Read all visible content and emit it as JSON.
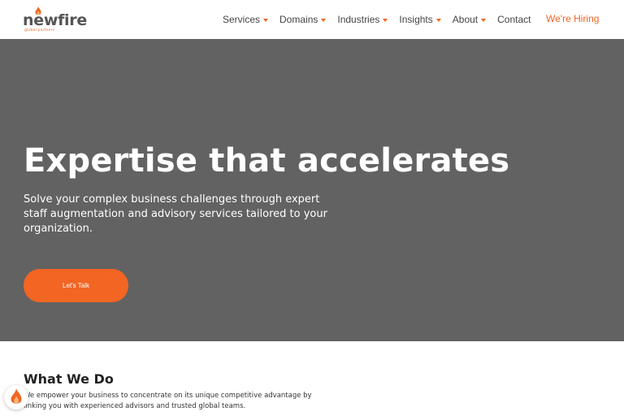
{
  "brand": {
    "name": "newfire",
    "tagline": "global partners",
    "accent_color": "#f26522",
    "hero_bg_color": "#626262"
  },
  "nav": {
    "items": [
      {
        "label": "Services",
        "has_dropdown": true
      },
      {
        "label": "Domains",
        "has_dropdown": true
      },
      {
        "label": "Industries",
        "has_dropdown": true
      },
      {
        "label": "Insights",
        "has_dropdown": true
      },
      {
        "label": "About",
        "has_dropdown": true
      },
      {
        "label": "Contact",
        "has_dropdown": false
      }
    ],
    "hiring_label": "We're Hiring"
  },
  "hero": {
    "title": "Expertise that accelerates",
    "subtitle": "Solve your complex business challenges through expert staff augmentation and advisory services tailored to your organization.",
    "cta_label": "Let's Talk"
  },
  "what_we_do": {
    "title": "What We Do",
    "text": "We empower your business to concentrate on its unique competitive advantage by linking you with experienced advisors and trusted global teams."
  },
  "icons": {
    "logo_flame": "flame-icon",
    "chat_badge": "flame-icon",
    "dropdown": "chevron-down-icon"
  }
}
